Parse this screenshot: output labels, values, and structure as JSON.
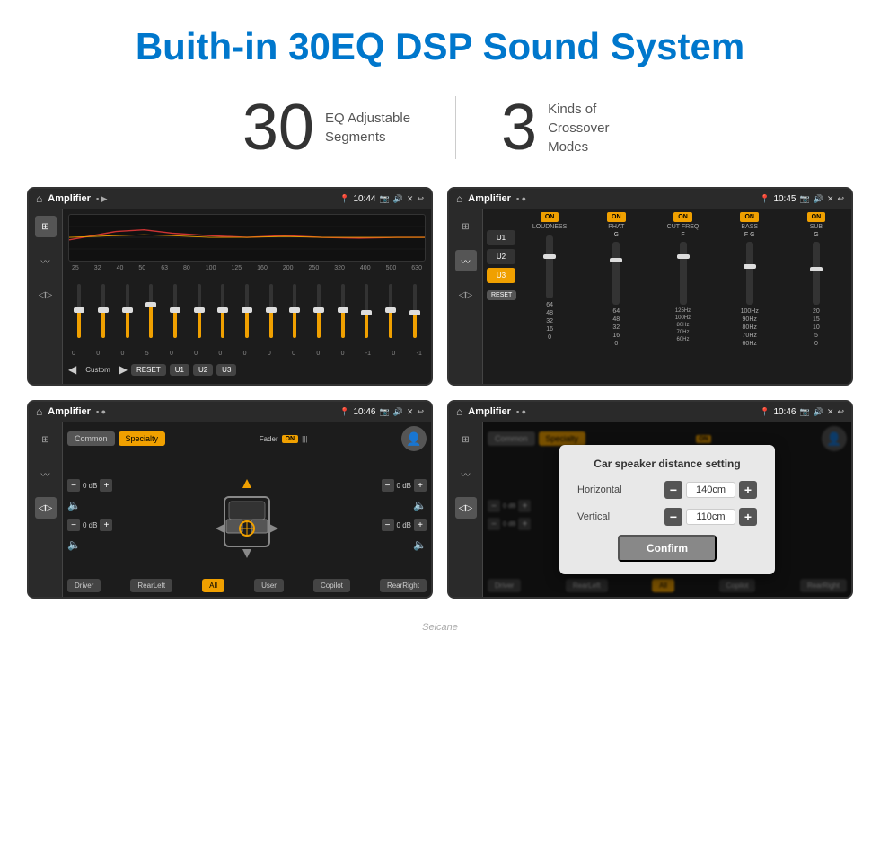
{
  "header": {
    "title": "Buith-in 30EQ DSP Sound System"
  },
  "stats": [
    {
      "number": "30",
      "label": "EQ Adjustable\nSegments"
    },
    {
      "number": "3",
      "label": "Kinds of\nCrossover Modes"
    }
  ],
  "screen1": {
    "statusBar": {
      "title": "Amplifier",
      "time": "10:44"
    },
    "freqLabels": [
      "25",
      "32",
      "40",
      "50",
      "63",
      "80",
      "100",
      "125",
      "160",
      "200",
      "250",
      "320",
      "400",
      "500",
      "630"
    ],
    "sliders": [
      {
        "val": 0,
        "pos": 50
      },
      {
        "val": 0,
        "pos": 50
      },
      {
        "val": 0,
        "pos": 50
      },
      {
        "val": 5,
        "pos": 60
      },
      {
        "val": 0,
        "pos": 50
      },
      {
        "val": 0,
        "pos": 50
      },
      {
        "val": 0,
        "pos": 50
      },
      {
        "val": 0,
        "pos": 50
      },
      {
        "val": 0,
        "pos": 50
      },
      {
        "val": 0,
        "pos": 50
      },
      {
        "val": 0,
        "pos": 50
      },
      {
        "val": 0,
        "pos": 50
      },
      {
        "val": -1,
        "pos": 45
      },
      {
        "val": 0,
        "pos": 50
      },
      {
        "val": -1,
        "pos": 45
      }
    ],
    "bottomBtns": [
      "Custom",
      "RESET",
      "U1",
      "U2",
      "U3"
    ]
  },
  "screen2": {
    "statusBar": {
      "title": "Amplifier",
      "time": "10:45"
    },
    "presets": [
      "U1",
      "U2",
      "U3"
    ],
    "activePreset": "U3",
    "bands": [
      {
        "name": "LOUDNESS",
        "toggle": "ON"
      },
      {
        "name": "PHAT",
        "toggle": "ON"
      },
      {
        "name": "CUT FREQ",
        "toggle": "ON"
      },
      {
        "name": "BASS",
        "toggle": "ON"
      },
      {
        "name": "SUB",
        "toggle": "ON"
      }
    ],
    "resetBtn": "RESET"
  },
  "screen3": {
    "statusBar": {
      "title": "Amplifier",
      "time": "10:46"
    },
    "tabs": [
      "Common",
      "Specialty"
    ],
    "activeTab": "Specialty",
    "faderLabel": "Fader",
    "faderState": "ON",
    "speakerLabels": {
      "topLeft": "0 dB",
      "topRight": "0 dB",
      "bottomLeft": "0 dB",
      "bottomRight": "0 dB"
    },
    "bottomBtns": [
      "Driver",
      "RearLeft",
      "All",
      "User",
      "Copilot",
      "RearRight"
    ],
    "activeBottomBtn": "All"
  },
  "screen4": {
    "statusBar": {
      "title": "Amplifier",
      "time": "10:46"
    },
    "tabs": [
      "Common",
      "Specialty"
    ],
    "activeTab": "Specialty",
    "dialog": {
      "title": "Car speaker distance setting",
      "rows": [
        {
          "label": "Horizontal",
          "value": "140cm"
        },
        {
          "label": "Vertical",
          "value": "110cm"
        }
      ],
      "confirmBtn": "Confirm"
    },
    "bottomBtns": [
      "Driver",
      "RearLeft",
      "All",
      "Copilot",
      "RearRight"
    ]
  },
  "watermark": "Seicane"
}
